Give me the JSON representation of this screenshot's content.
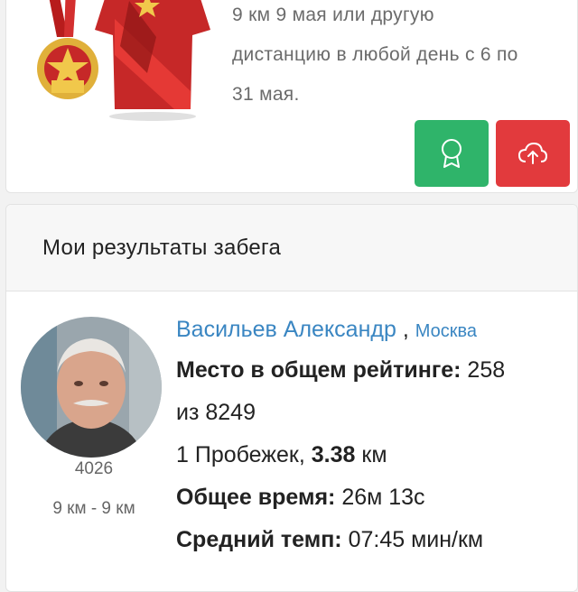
{
  "event": {
    "description_lines": [
      "9 км 9 мая или другую",
      "дистанцию в любой день с 6 по",
      "31 мая."
    ]
  },
  "buttons": {
    "certificate_icon": "award-icon",
    "upload_icon": "cloud-upload-icon"
  },
  "results": {
    "header": "Мои результаты забега",
    "runner": {
      "name": "Васильев Александр",
      "separator": ",",
      "city": "Москва",
      "bib": "4026",
      "distance": "9 км - 9 км",
      "place_label": "Место в общем рейтинге:",
      "place_value": "258",
      "place_total": "из 8249",
      "runs_prefix": "1 Пробежек,",
      "runs_distance": "3.38",
      "runs_unit": "км",
      "time_label": "Общее время:",
      "time_value": "26м 13с",
      "pace_label": "Средний темп:",
      "pace_value": "07:45 мин/км"
    }
  },
  "colors": {
    "green_button": "#2fb46a",
    "red_button": "#e23a3d",
    "link": "#3a86c2"
  }
}
